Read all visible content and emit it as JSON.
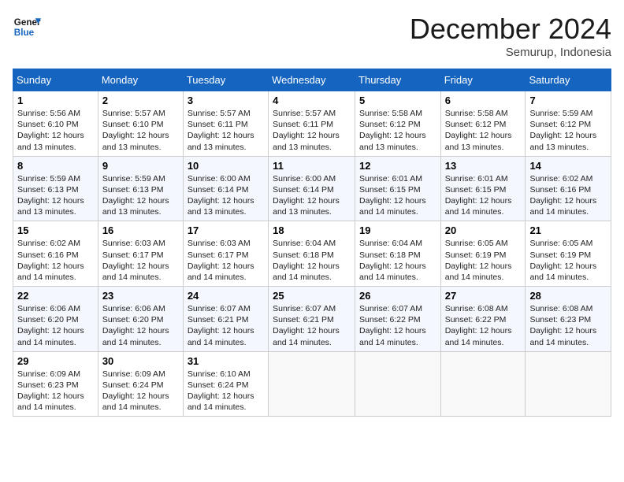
{
  "header": {
    "logo_general": "General",
    "logo_blue": "Blue",
    "month_title": "December 2024",
    "location": "Semurup, Indonesia"
  },
  "weekdays": [
    "Sunday",
    "Monday",
    "Tuesday",
    "Wednesday",
    "Thursday",
    "Friday",
    "Saturday"
  ],
  "weeks": [
    [
      {
        "day": "1",
        "sunrise": "5:56 AM",
        "sunset": "6:10 PM",
        "daylight": "12 hours and 13 minutes."
      },
      {
        "day": "2",
        "sunrise": "5:57 AM",
        "sunset": "6:10 PM",
        "daylight": "12 hours and 13 minutes."
      },
      {
        "day": "3",
        "sunrise": "5:57 AM",
        "sunset": "6:11 PM",
        "daylight": "12 hours and 13 minutes."
      },
      {
        "day": "4",
        "sunrise": "5:57 AM",
        "sunset": "6:11 PM",
        "daylight": "12 hours and 13 minutes."
      },
      {
        "day": "5",
        "sunrise": "5:58 AM",
        "sunset": "6:12 PM",
        "daylight": "12 hours and 13 minutes."
      },
      {
        "day": "6",
        "sunrise": "5:58 AM",
        "sunset": "6:12 PM",
        "daylight": "12 hours and 13 minutes."
      },
      {
        "day": "7",
        "sunrise": "5:59 AM",
        "sunset": "6:12 PM",
        "daylight": "12 hours and 13 minutes."
      }
    ],
    [
      {
        "day": "8",
        "sunrise": "5:59 AM",
        "sunset": "6:13 PM",
        "daylight": "12 hours and 13 minutes."
      },
      {
        "day": "9",
        "sunrise": "5:59 AM",
        "sunset": "6:13 PM",
        "daylight": "12 hours and 13 minutes."
      },
      {
        "day": "10",
        "sunrise": "6:00 AM",
        "sunset": "6:14 PM",
        "daylight": "12 hours and 13 minutes."
      },
      {
        "day": "11",
        "sunrise": "6:00 AM",
        "sunset": "6:14 PM",
        "daylight": "12 hours and 13 minutes."
      },
      {
        "day": "12",
        "sunrise": "6:01 AM",
        "sunset": "6:15 PM",
        "daylight": "12 hours and 14 minutes."
      },
      {
        "day": "13",
        "sunrise": "6:01 AM",
        "sunset": "6:15 PM",
        "daylight": "12 hours and 14 minutes."
      },
      {
        "day": "14",
        "sunrise": "6:02 AM",
        "sunset": "6:16 PM",
        "daylight": "12 hours and 14 minutes."
      }
    ],
    [
      {
        "day": "15",
        "sunrise": "6:02 AM",
        "sunset": "6:16 PM",
        "daylight": "12 hours and 14 minutes."
      },
      {
        "day": "16",
        "sunrise": "6:03 AM",
        "sunset": "6:17 PM",
        "daylight": "12 hours and 14 minutes."
      },
      {
        "day": "17",
        "sunrise": "6:03 AM",
        "sunset": "6:17 PM",
        "daylight": "12 hours and 14 minutes."
      },
      {
        "day": "18",
        "sunrise": "6:04 AM",
        "sunset": "6:18 PM",
        "daylight": "12 hours and 14 minutes."
      },
      {
        "day": "19",
        "sunrise": "6:04 AM",
        "sunset": "6:18 PM",
        "daylight": "12 hours and 14 minutes."
      },
      {
        "day": "20",
        "sunrise": "6:05 AM",
        "sunset": "6:19 PM",
        "daylight": "12 hours and 14 minutes."
      },
      {
        "day": "21",
        "sunrise": "6:05 AM",
        "sunset": "6:19 PM",
        "daylight": "12 hours and 14 minutes."
      }
    ],
    [
      {
        "day": "22",
        "sunrise": "6:06 AM",
        "sunset": "6:20 PM",
        "daylight": "12 hours and 14 minutes."
      },
      {
        "day": "23",
        "sunrise": "6:06 AM",
        "sunset": "6:20 PM",
        "daylight": "12 hours and 14 minutes."
      },
      {
        "day": "24",
        "sunrise": "6:07 AM",
        "sunset": "6:21 PM",
        "daylight": "12 hours and 14 minutes."
      },
      {
        "day": "25",
        "sunrise": "6:07 AM",
        "sunset": "6:21 PM",
        "daylight": "12 hours and 14 minutes."
      },
      {
        "day": "26",
        "sunrise": "6:07 AM",
        "sunset": "6:22 PM",
        "daylight": "12 hours and 14 minutes."
      },
      {
        "day": "27",
        "sunrise": "6:08 AM",
        "sunset": "6:22 PM",
        "daylight": "12 hours and 14 minutes."
      },
      {
        "day": "28",
        "sunrise": "6:08 AM",
        "sunset": "6:23 PM",
        "daylight": "12 hours and 14 minutes."
      }
    ],
    [
      {
        "day": "29",
        "sunrise": "6:09 AM",
        "sunset": "6:23 PM",
        "daylight": "12 hours and 14 minutes."
      },
      {
        "day": "30",
        "sunrise": "6:09 AM",
        "sunset": "6:24 PM",
        "daylight": "12 hours and 14 minutes."
      },
      {
        "day": "31",
        "sunrise": "6:10 AM",
        "sunset": "6:24 PM",
        "daylight": "12 hours and 14 minutes."
      },
      null,
      null,
      null,
      null
    ]
  ]
}
